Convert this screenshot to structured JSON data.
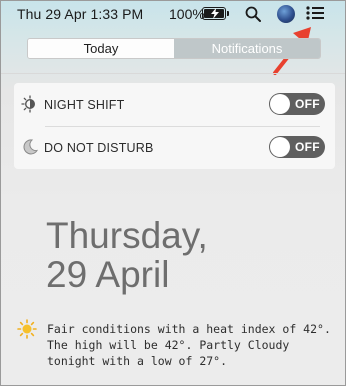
{
  "menubar": {
    "clock": "Thu 29 Apr  1:33 PM",
    "battery_percent": "100%",
    "icons": [
      "battery-charging-icon",
      "search-icon",
      "siri-icon",
      "notification-center-list-icon"
    ]
  },
  "annotation": {
    "arrow_color": "#e8412f"
  },
  "segmented": {
    "today_label": "Today",
    "notifications_label": "Notifications",
    "active": "Today"
  },
  "toggles": [
    {
      "label": "NIGHT SHIFT",
      "state": "OFF",
      "icon": "night-shift-icon"
    },
    {
      "label": "DO NOT DISTURB",
      "state": "OFF",
      "icon": "moon-icon"
    }
  ],
  "date": {
    "weekday": "Thursday,",
    "day_month": "29 April"
  },
  "weather": {
    "icon": "sun-icon",
    "text": "Fair conditions with a heat index of 42°. The high will be 42°. Partly Cloudy tonight with a low of 27°."
  }
}
